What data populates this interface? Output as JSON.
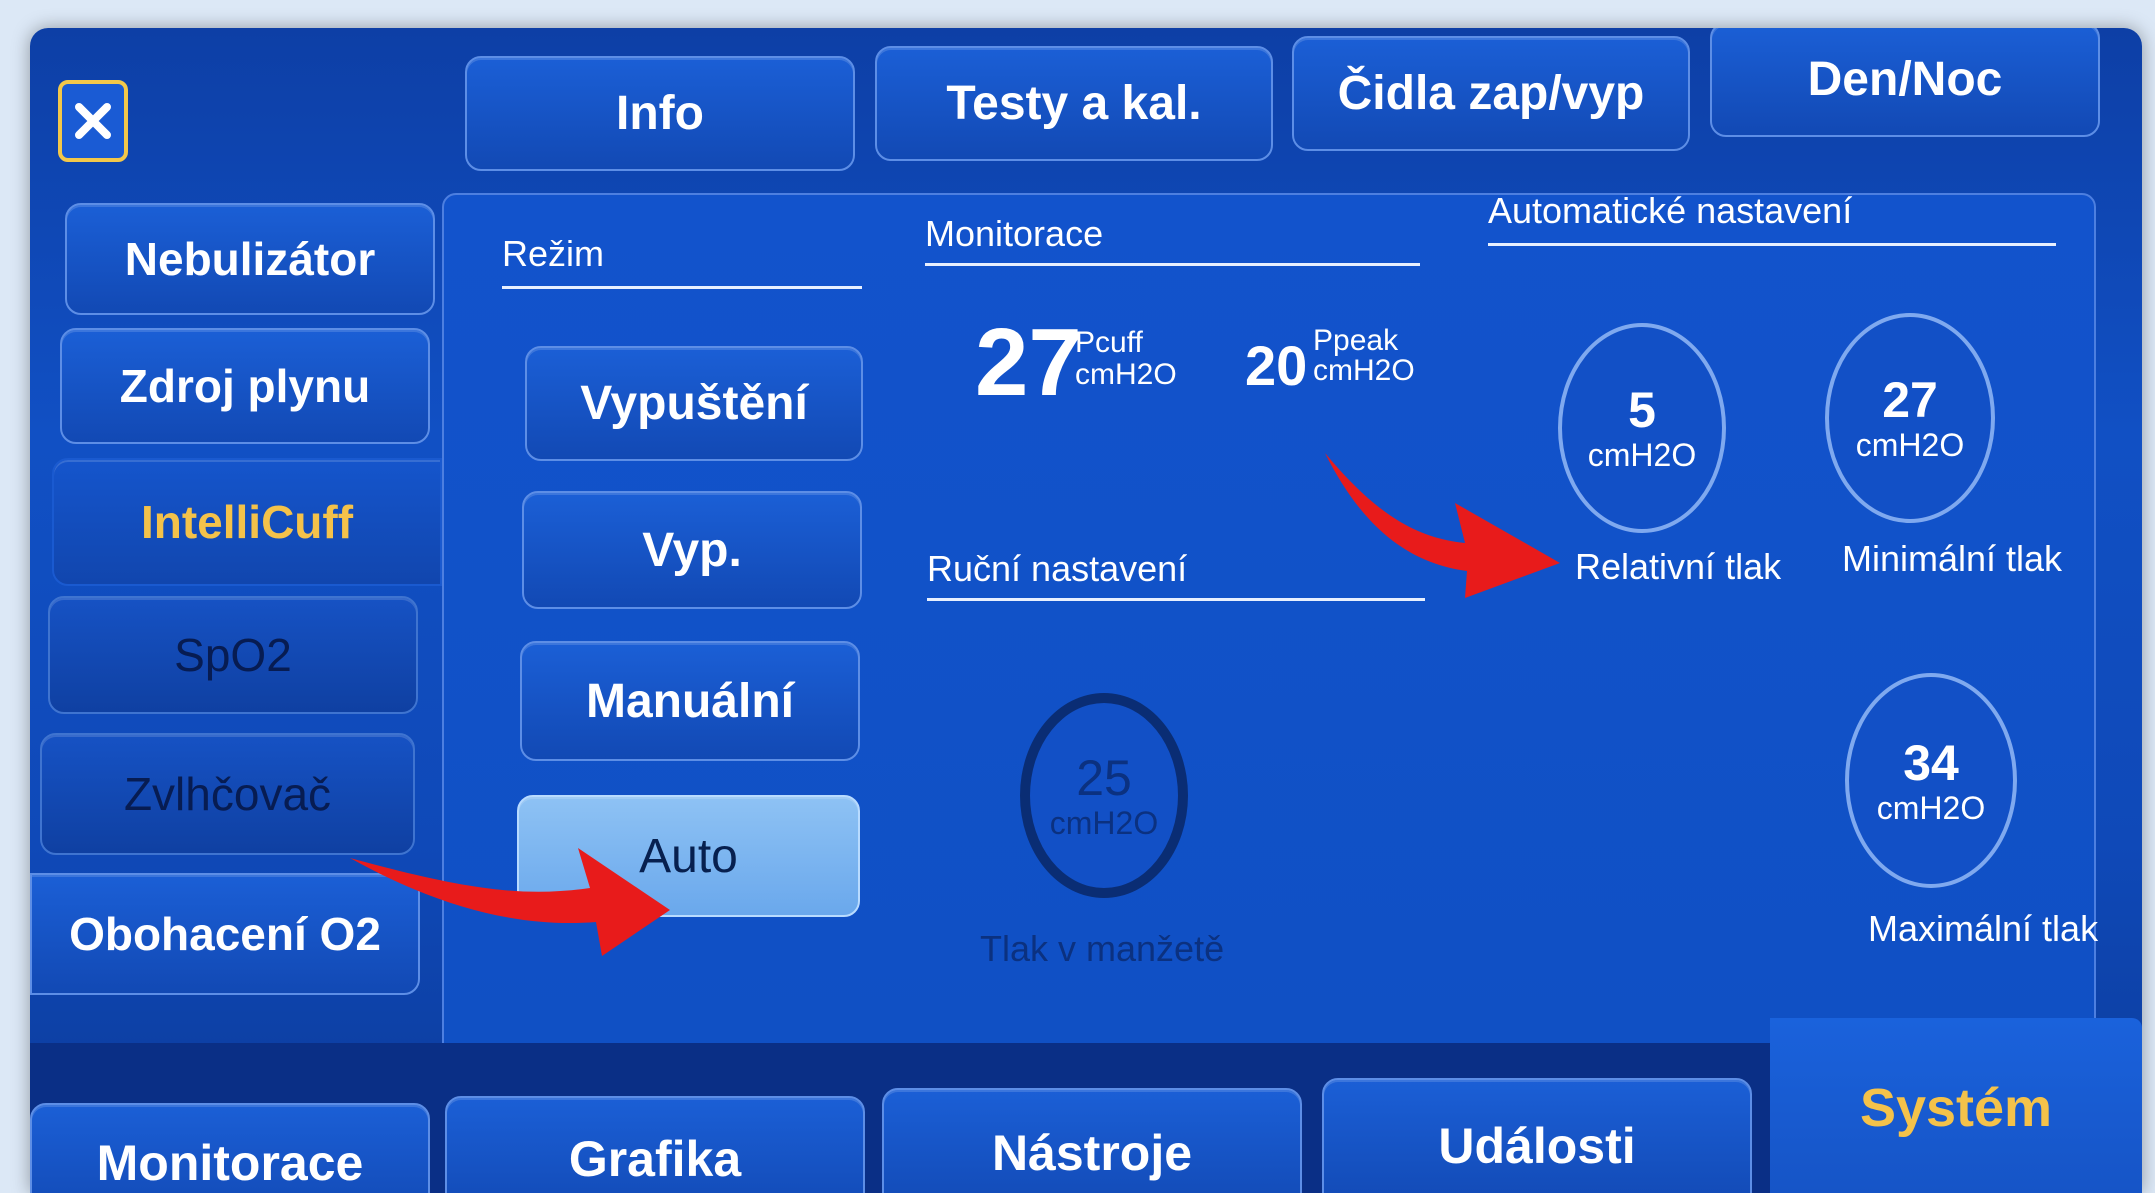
{
  "top_tabs": [
    "Info",
    "Testy a kal.",
    "Čidla zap/vyp",
    "Den/Noc"
  ],
  "sidebar": {
    "items": [
      {
        "label": "Nebulizátor"
      },
      {
        "label": "Zdroj plynu"
      },
      {
        "label": "IntelliCuff"
      },
      {
        "label": "SpO2"
      },
      {
        "label": "Zvlhčovač"
      },
      {
        "label": "Obohacení O2"
      }
    ]
  },
  "mode": {
    "title": "Režim",
    "buttons": [
      "Vypuštění",
      "Vyp.",
      "Manuální",
      "Auto"
    ],
    "selected": "Auto"
  },
  "monitoring": {
    "title": "Monitorace",
    "pcuff_value": "27",
    "pcuff_label": "Pcuff",
    "pcuff_unit": "cmH2O",
    "ppeak_value": "20",
    "ppeak_label": "Ppeak",
    "ppeak_unit": "cmH2O"
  },
  "manual": {
    "title": "Ruční nastavení",
    "cuff_value": "25",
    "cuff_unit": "cmH2O",
    "cuff_label": "Tlak v manžetě"
  },
  "auto": {
    "title": "Automatické nastavení",
    "relative_value": "5",
    "relative_unit": "cmH2O",
    "relative_label": "Relativní tlak",
    "minimum_value": "27",
    "minimum_unit": "cmH2O",
    "minimum_label": "Minimální tlak",
    "maximum_value": "34",
    "maximum_unit": "cmH2O",
    "maximum_label": "Maximální tlak"
  },
  "bottom_tabs": [
    "Monitorace",
    "Grafika",
    "Nástroje",
    "Události",
    "Systém"
  ],
  "colors": {
    "background": "#1150c4",
    "selected_text": "#f4c24a",
    "auto_button": "#8ec2f4",
    "annotation_arrow": "#e81b1b"
  },
  "icons": {
    "close": "close-icon",
    "arrow": "red-arrow-annotation"
  }
}
